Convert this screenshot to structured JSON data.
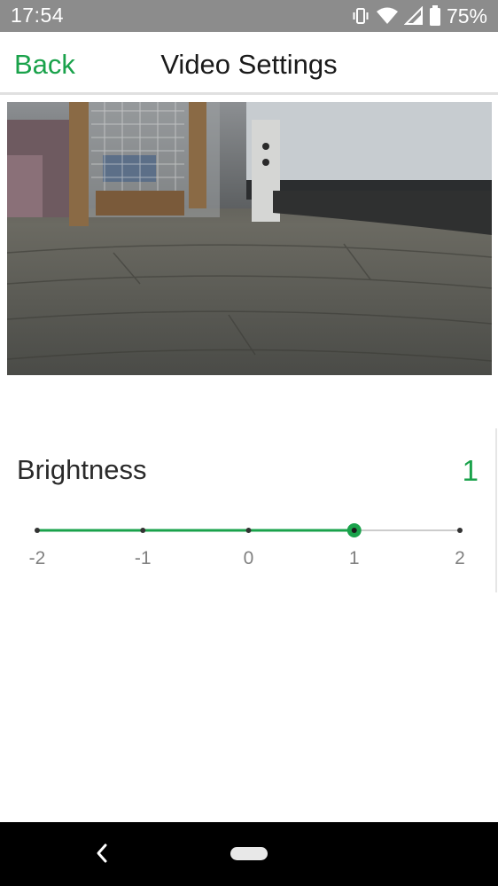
{
  "status_bar": {
    "time": "17:54",
    "battery_percent": "75%",
    "icons": [
      "vibrate-icon",
      "wifi-icon",
      "cell-signal-icon",
      "battery-icon"
    ]
  },
  "header": {
    "back_label": "Back",
    "title": "Video Settings"
  },
  "preview": {
    "content": "live-camera-frame-icon"
  },
  "brightness": {
    "label": "Brightness",
    "value": "1",
    "current": 1,
    "min": -2,
    "max": 2,
    "ticks": [
      "-2",
      "-1",
      "0",
      "1",
      "2"
    ]
  },
  "colors": {
    "accent": "#1aa24b",
    "status_bar": "#8c8c8c",
    "track_inactive": "#cccccc",
    "tick_label": "#808080"
  },
  "nav_bar": {
    "icons": [
      "back-chevron-icon",
      "home-pill-icon"
    ]
  }
}
